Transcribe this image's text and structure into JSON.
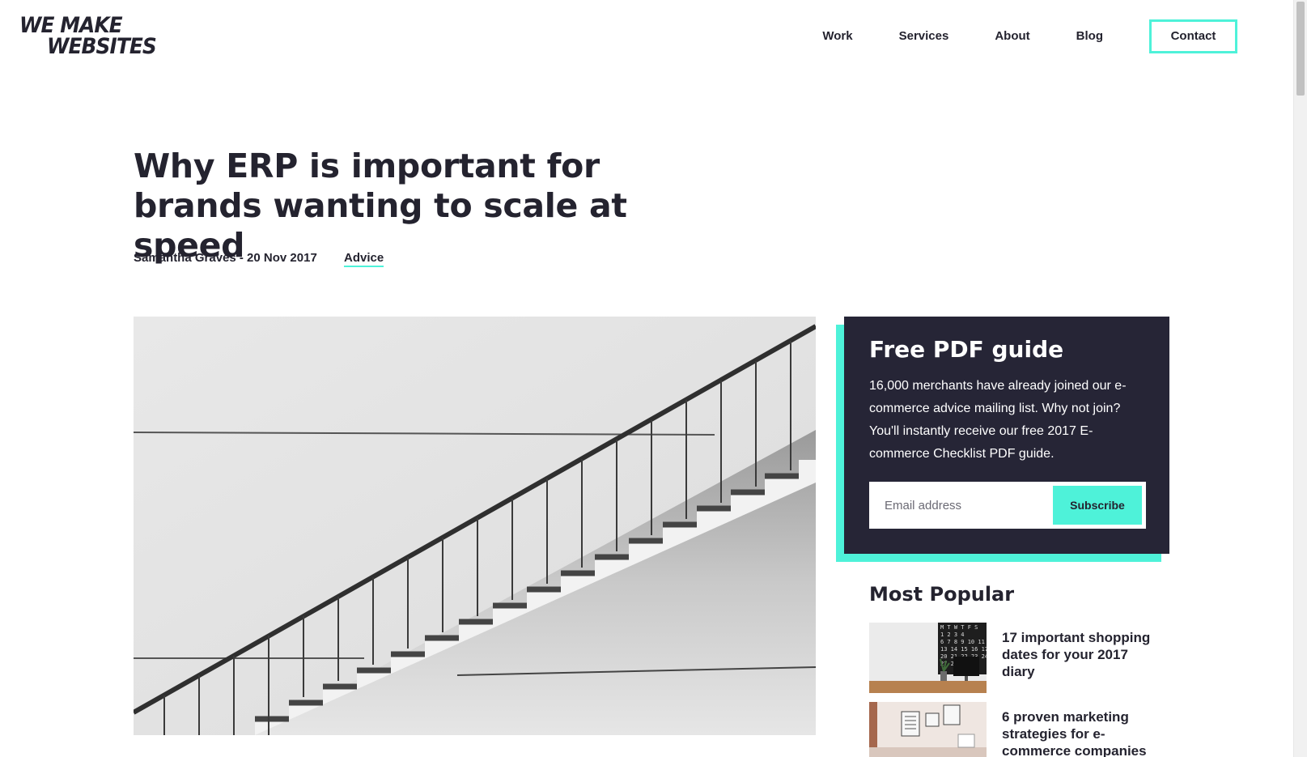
{
  "header": {
    "logo_line1": "WE MAKE",
    "logo_line2": "WEBSITES",
    "nav": [
      {
        "label": "Work"
      },
      {
        "label": "Services"
      },
      {
        "label": "About"
      },
      {
        "label": "Blog"
      },
      {
        "label": "Contact"
      }
    ]
  },
  "article": {
    "title": "Why ERP is important for brands wanting to scale at speed",
    "author_date": "Samantha Graves - 20 Nov 2017",
    "category": "Advice"
  },
  "sidebar": {
    "pdf_guide": {
      "heading": "Free PDF guide",
      "body": "16,000 merchants have already joined our e-commerce advice mailing list. Why not join? You'll instantly receive our free 2017 E-commerce Checklist PDF guide.",
      "email_placeholder": "Email address",
      "subscribe_label": "Subscribe"
    },
    "most_popular": {
      "heading": "Most Popular",
      "items": [
        {
          "title": "17 important shopping dates for your 2017 diary"
        },
        {
          "title": "6 proven marketing strategies for e-commerce companies"
        }
      ]
    }
  },
  "colors": {
    "accent": "#4ef2d9",
    "dark": "#262536",
    "text": "#24232f"
  }
}
